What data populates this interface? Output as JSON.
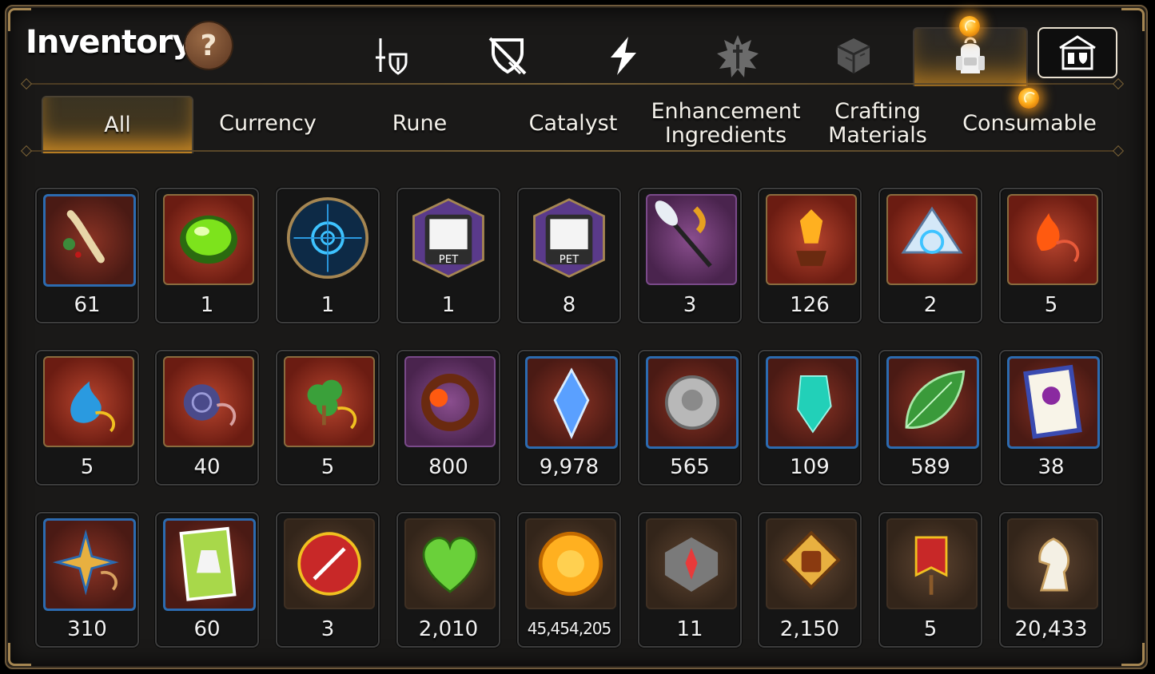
{
  "header": {
    "title": "Inventory",
    "help_label": "?"
  },
  "category_tabs": [
    {
      "icon": "sword-shield-icon"
    },
    {
      "icon": "broken-shield-icon"
    },
    {
      "icon": "lightning-icon"
    },
    {
      "icon": "burst-sword-icon"
    },
    {
      "icon": "cube-icon"
    },
    {
      "icon": "backpack-icon",
      "active": true
    },
    {
      "icon": "guild-hall-icon"
    }
  ],
  "subtabs": [
    "All",
    "Currency",
    "Rune",
    "Catalyst",
    "Enhancement Ingredients",
    "Crafting Materials",
    "Consumable"
  ],
  "active_subtab": "All",
  "items": [
    {
      "icon": "ginseng-root-icon",
      "count": "61"
    },
    {
      "icon": "green-orb-icon",
      "count": "1"
    },
    {
      "icon": "blue-rune-circle-icon",
      "count": "1"
    },
    {
      "icon": "pet-bag-icon",
      "count": "1"
    },
    {
      "icon": "pet-bag-icon",
      "count": "8"
    },
    {
      "icon": "feather-duster-icon",
      "count": "3"
    },
    {
      "icon": "flame-crystal-icon",
      "count": "126"
    },
    {
      "icon": "triquetra-crystal-icon",
      "count": "2"
    },
    {
      "icon": "fire-pendant-icon",
      "count": "5"
    },
    {
      "icon": "water-pendant-icon",
      "count": "5"
    },
    {
      "icon": "spiral-pendant-icon",
      "count": "40"
    },
    {
      "icon": "clover-pendant-icon",
      "count": "5"
    },
    {
      "icon": "flower-bracelet-icon",
      "count": "800"
    },
    {
      "icon": "blue-gem-icon",
      "count": "9,978"
    },
    {
      "icon": "silver-coin-icon",
      "count": "565"
    },
    {
      "icon": "teal-crystal-icon",
      "count": "109"
    },
    {
      "icon": "leaf-icon",
      "count": "589"
    },
    {
      "icon": "paw-card-icon",
      "count": "38"
    },
    {
      "icon": "star-pendant-icon",
      "count": "310"
    },
    {
      "icon": "dress-card-icon",
      "count": "60"
    },
    {
      "icon": "red-badge-icon",
      "count": "3"
    },
    {
      "icon": "green-heart-icon",
      "count": "2,010"
    },
    {
      "icon": "gold-coin-icon",
      "count": "45,454,205"
    },
    {
      "icon": "compass-stone-icon",
      "count": "11"
    },
    {
      "icon": "fist-emblem-icon",
      "count": "2,150"
    },
    {
      "icon": "war-banner-icon",
      "count": "5"
    },
    {
      "icon": "chess-knight-icon",
      "count": "20,433"
    }
  ]
}
